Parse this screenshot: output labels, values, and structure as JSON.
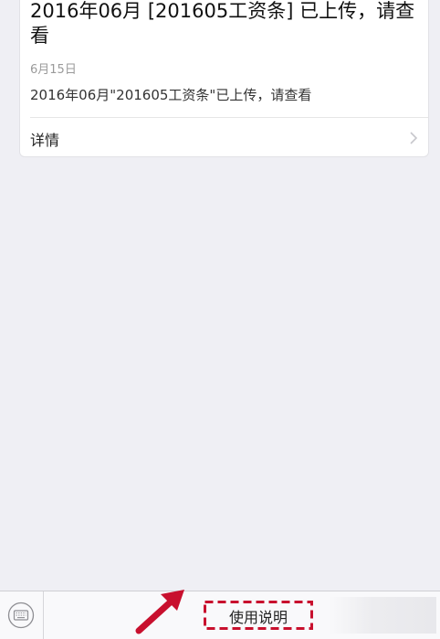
{
  "message_card": {
    "title": "2016年06月 [201605工资条] 已上传，请查看",
    "date": "6月15日",
    "description": "2016年06月\"201605工资条\"已上传，请查看",
    "detail_label": "详情"
  },
  "bottom_menu": {
    "keyboard_icon": "keyboard-icon",
    "items": [
      {
        "label": "使用说明"
      }
    ]
  },
  "annotation": {
    "color": "#c8102e"
  }
}
